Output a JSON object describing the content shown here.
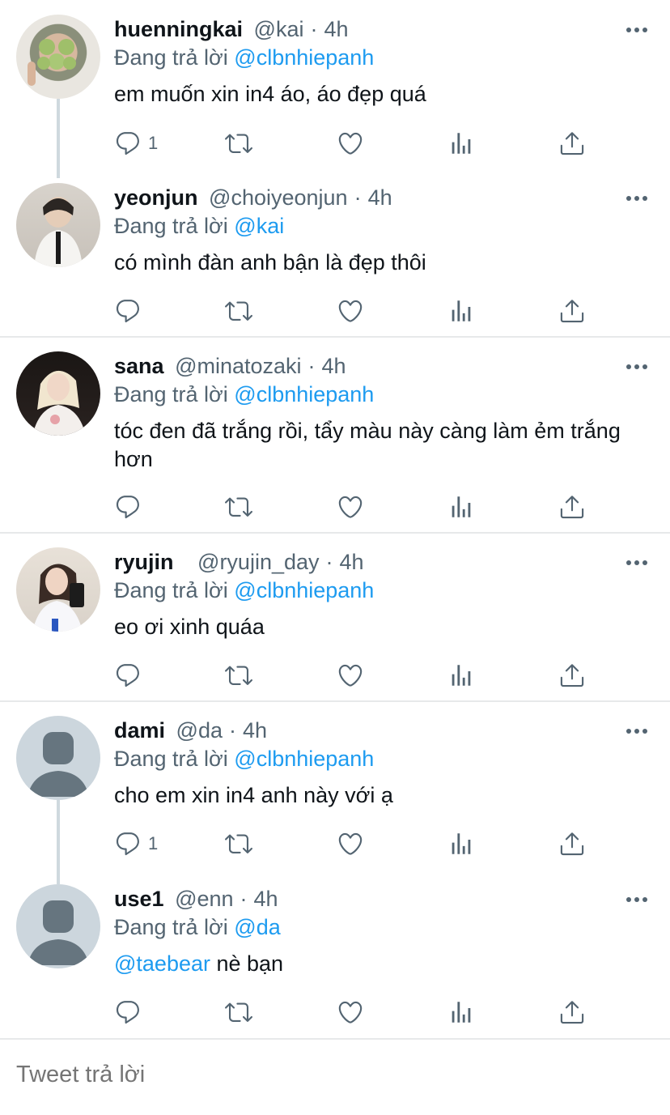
{
  "tweets": [
    {
      "name": "huenningkai",
      "handle": "@kai",
      "time": "4h",
      "replying_label": "Đang trả lời",
      "replying_to": "@clbnhiepanh",
      "text": "em muốn xin in4 áo, áo đẹp quá",
      "reply_count": "1"
    },
    {
      "name": "yeonjun",
      "handle": "@choiyeonjun",
      "time": "4h",
      "replying_label": "Đang trả lời",
      "replying_to": "@kai",
      "text": "có mình đàn anh bận là đẹp thôi",
      "reply_count": ""
    },
    {
      "name": "sana",
      "handle": "@minatozaki",
      "time": "4h",
      "replying_label": "Đang trả lời",
      "replying_to": "@clbnhiepanh",
      "text": "tóc đen đã trắng rồi, tẩy màu này càng làm ẻm trắng hơn",
      "reply_count": ""
    },
    {
      "name": "ryujin",
      "handle": "@ryujin_day",
      "time": "4h",
      "replying_label": "Đang trả lời",
      "replying_to": "@clbnhiepanh",
      "text": "eo ơi xinh quáa",
      "reply_count": ""
    },
    {
      "name": "dami",
      "handle": "@da",
      "time": "4h",
      "replying_label": "Đang trả lời",
      "replying_to": "@clbnhiepanh",
      "text": "cho em xin in4 anh này với ạ",
      "reply_count": "1"
    },
    {
      "name": "use1",
      "handle": "@enn",
      "time": "4h",
      "replying_label": "Đang trả lời",
      "replying_to": "@da",
      "text_mention": "@taebear",
      "text_rest": " nè bạn",
      "reply_count": ""
    }
  ],
  "reply_box": {
    "placeholder": "Tweet trả lời"
  },
  "colors": {
    "accent": "#1d9bf0",
    "muted": "#536471",
    "divider": "#e7e9ea",
    "thread_line": "#cfd9de"
  }
}
